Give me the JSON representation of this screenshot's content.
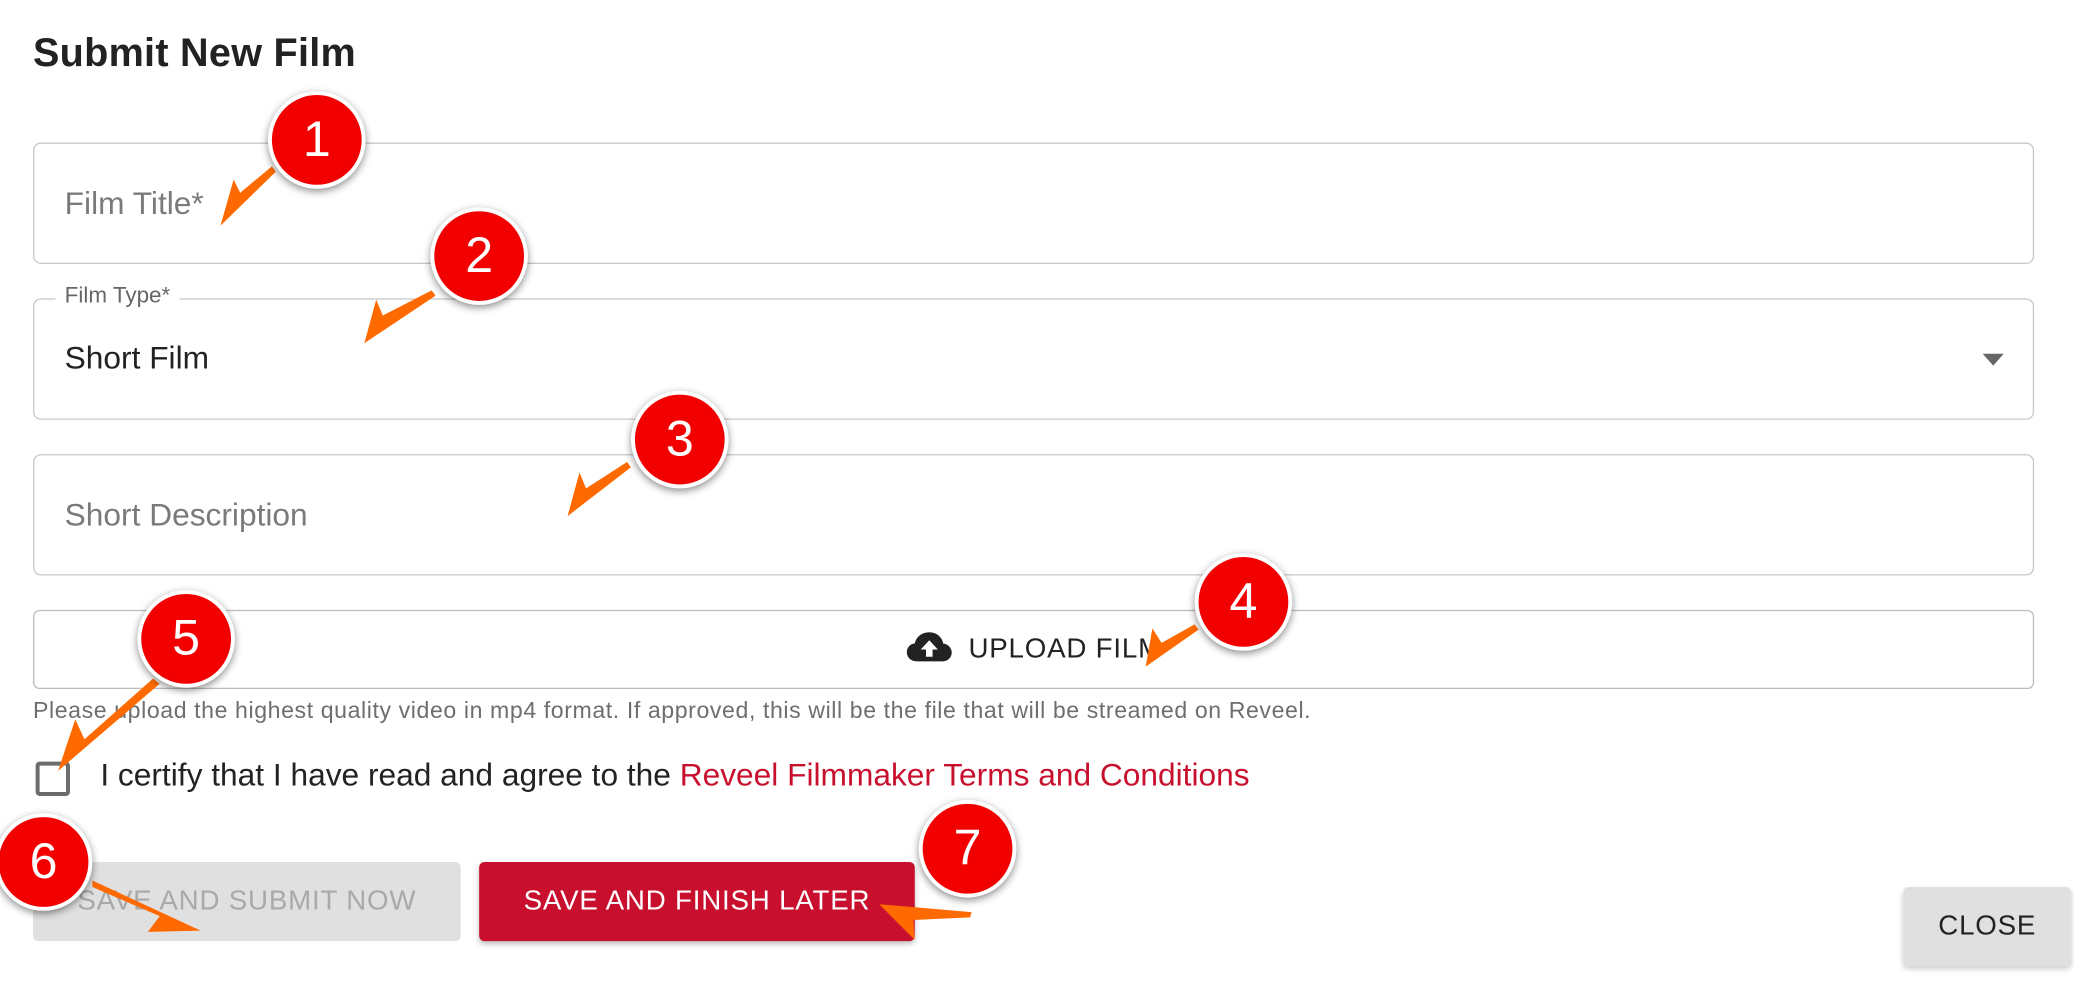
{
  "page": {
    "title": "Submit New Film"
  },
  "form": {
    "film_title": {
      "placeholder": "Film Title*",
      "value": ""
    },
    "film_type": {
      "label": "Film Type*",
      "selected": "Short Film"
    },
    "short_description": {
      "placeholder": "Short Description",
      "value": ""
    },
    "upload": {
      "label": "UPLOAD FILM",
      "icon": "cloud-upload-icon"
    },
    "helper_text": "Please upload the highest quality video in mp4 format. If approved, this will be the file that will be streamed on Reveel.",
    "certify": {
      "checked": false,
      "text": "I certify that I have read and agree to the ",
      "link_text": "Reveel Filmmaker Terms and Conditions"
    }
  },
  "actions": {
    "submit_now": "SAVE AND SUBMIT NOW",
    "finish_later": "SAVE AND FINISH LATER",
    "close": "CLOSE"
  },
  "annotations": {
    "badges": [
      "1",
      "2",
      "3",
      "4",
      "5",
      "6",
      "7"
    ],
    "badge_color": "#f20000",
    "arrow_color": "#ff6a00"
  },
  "colors": {
    "accent": "#c8102e",
    "disabled_bg": "#e0e0e0",
    "border": "#c8c8c8"
  }
}
